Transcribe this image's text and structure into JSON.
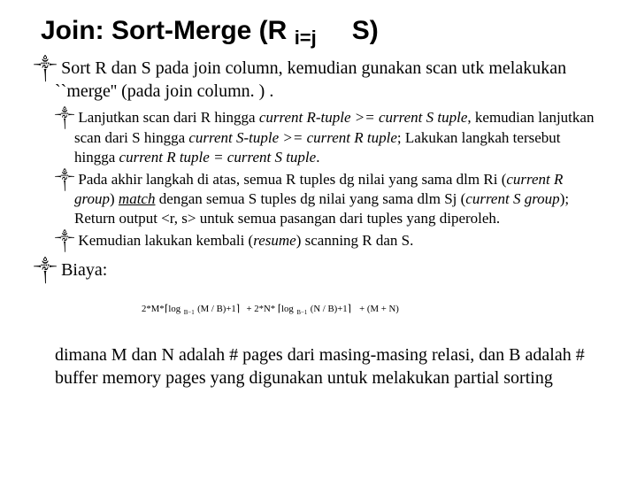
{
  "title": {
    "prefix": "Join: Sort-Merge (R",
    "sub": "i=j",
    "suffix": "S)"
  },
  "l1_a": "Sort R dan S pada join column, kemudian gunakan scan utk melakukan ``merge'' (pada join column. ) .",
  "l2_a": {
    "t1": "Lanjutkan scan dari R hingga ",
    "e1": "current R-tuple >= current S tuple",
    "t2": ", kemudian lanjutkan scan dari S hingga ",
    "e2": "current S-tuple >= current R tuple",
    "t3": "; Lakukan langkah tersebut hingga ",
    "e3": "current R tuple = current S tuple",
    "t4": "."
  },
  "l2_b": {
    "t1": "Pada akhir langkah di atas, semua R tuples dg nilai yang sama dlm Ri (",
    "e1": "current R group",
    "t2": ") ",
    "u1": "match",
    "t3": " dengan semua S tuples dg nilai yang sama dlm Sj (",
    "e2": "current S group",
    "t4": ");  Return output <r, s> untuk semua pasangan dari tuples yang diperoleh."
  },
  "l2_c": {
    "t1": "Kemudian lakukan kembali (",
    "e1": "resume",
    "t2": ") scanning R dan S."
  },
  "l1_b": "Biaya:",
  "cost_formula": "2*M*⌈log_{B-1}(M/B)+1⌉ + 2*N*⌈log_{B-1}(N/B)+1⌉ + (M+N)",
  "closing": "dimana M dan N adalah # pages dari masing-masing relasi, dan B adalah # buffer memory pages yang digunakan untuk melakukan partial sorting",
  "bullet_mark": "༒"
}
